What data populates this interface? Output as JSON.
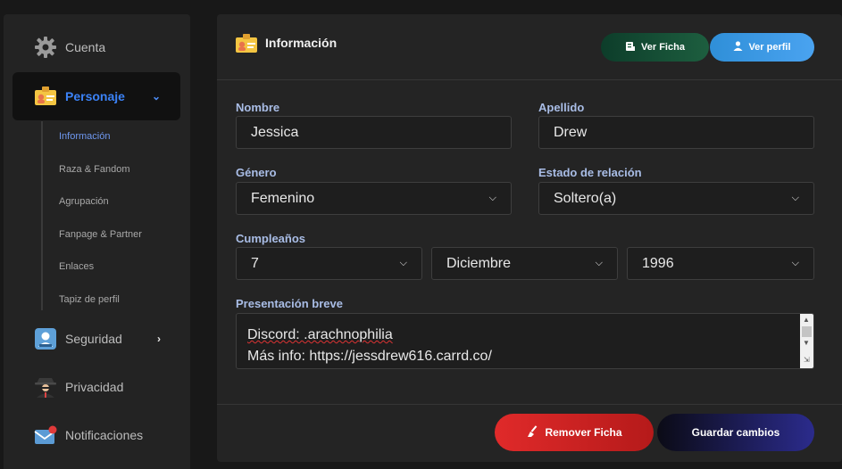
{
  "sidebar": {
    "items": [
      {
        "label": "Cuenta",
        "icon": "gear-icon"
      },
      {
        "label": "Personaje",
        "icon": "id-card-icon"
      },
      {
        "label": "Seguridad",
        "icon": "shield-user-icon"
      },
      {
        "label": "Privacidad",
        "icon": "spy-icon"
      },
      {
        "label": "Notificaciones",
        "icon": "bell-envelope-icon"
      }
    ],
    "subitems": [
      "Información",
      "Raza & Fandom",
      "Agrupación",
      "Fanpage & Partner",
      "Enlaces",
      "Tapiz de perfil"
    ]
  },
  "header": {
    "title": "Información",
    "ver_ficha": "Ver Ficha",
    "ver_perfil": "Ver perfil"
  },
  "form": {
    "nombre_label": "Nombre",
    "nombre_value": "Jessica",
    "apellido_label": "Apellido",
    "apellido_value": "Drew",
    "genero_label": "Género",
    "genero_value": "Femenino",
    "estado_label": "Estado de relación",
    "estado_value": "Soltero(a)",
    "cumple_label": "Cumpleaños",
    "cumple_day": "7",
    "cumple_month": "Diciembre",
    "cumple_year": "1996",
    "presentacion_label": "Presentación breve",
    "presentacion_line1": "Discord: .arachnophilia",
    "presentacion_line2": "Más info: https://jessdrew616.carrd.co/"
  },
  "footer": {
    "remove": "Remover Ficha",
    "save": "Guardar cambios"
  },
  "colors": {
    "accent": "#3b82f6",
    "danger": "#e02a2a",
    "success": "#1d5e3f"
  }
}
